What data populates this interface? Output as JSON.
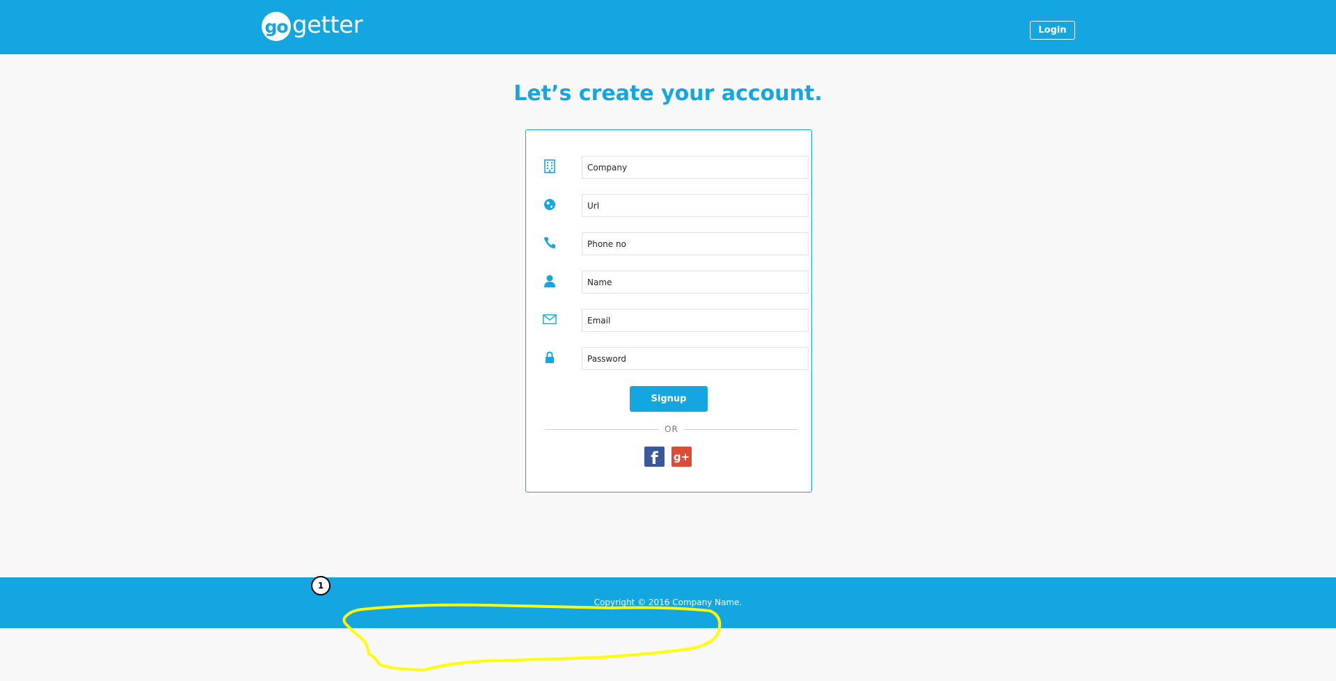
{
  "header": {
    "logo_mark": "go",
    "logo_text": "getter",
    "login_label": "Login"
  },
  "main": {
    "title": "Let’s create your account."
  },
  "form": {
    "fields": [
      {
        "placeholder": "Company",
        "icon": "building-icon"
      },
      {
        "placeholder": "Url",
        "icon": "globe-icon"
      },
      {
        "placeholder": "Phone no",
        "icon": "phone-icon"
      },
      {
        "placeholder": "Name",
        "icon": "user-icon"
      },
      {
        "placeholder": "Email",
        "icon": "envelope-icon"
      },
      {
        "placeholder": "Password",
        "icon": "lock-icon"
      }
    ],
    "signup_label": "Signup",
    "divider_text": "OR",
    "social": {
      "facebook_glyph": "f",
      "google_glyph": "g+"
    }
  },
  "footer": {
    "copyright": "Copyright © 2016 Company Name."
  },
  "annotation": {
    "marker_label": "1",
    "highlight_color": "#ffff00"
  },
  "colors": {
    "brand": "#14a6e0",
    "background": "#f8f8f8",
    "facebook": "#3b5998",
    "google": "#dd4b39"
  }
}
